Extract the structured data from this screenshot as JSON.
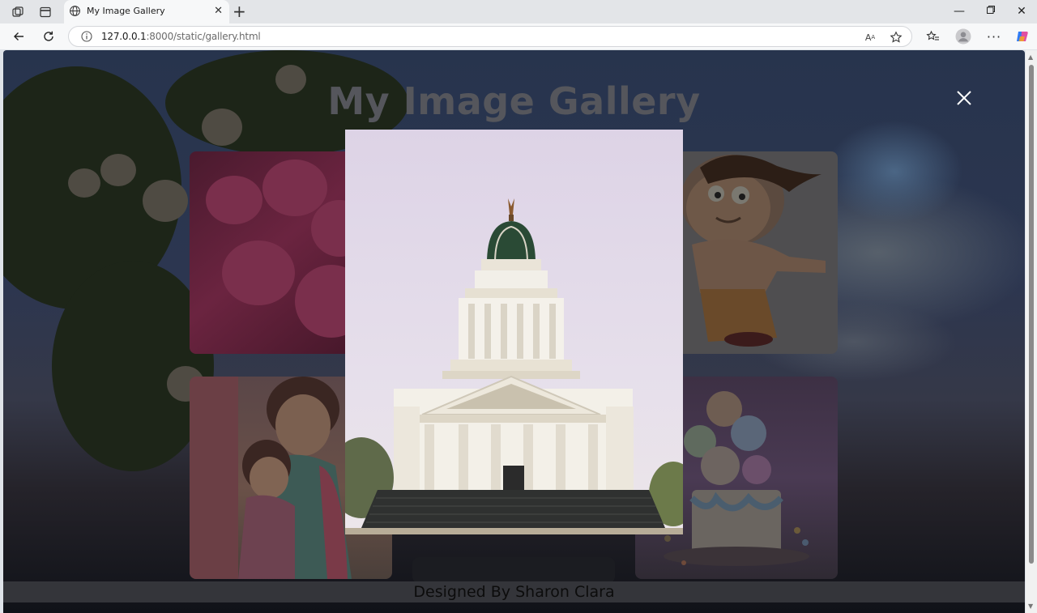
{
  "browser": {
    "tab_title": "My Image Gallery",
    "url_host": "127.0.0.1",
    "url_path": ":8000/static/gallery.html",
    "reader_label": "Aᴬ"
  },
  "page": {
    "title": "My Image Gallery",
    "footer": "Designed By Sharon Clara"
  },
  "lightbox": {
    "image_name": "domed-building-icon",
    "close_icon": "close-icon"
  },
  "thumbnails": [
    {
      "name": "pink-flowers-teddy-image"
    },
    {
      "name": "cartoon-boy-image"
    },
    {
      "name": "mother-daughter-hug-image"
    },
    {
      "name": "ice-cream-cake-image"
    }
  ],
  "colors": {
    "overlay": "#27344d",
    "title": "#55565c",
    "lightbox_sky": "#e3dbe9"
  }
}
